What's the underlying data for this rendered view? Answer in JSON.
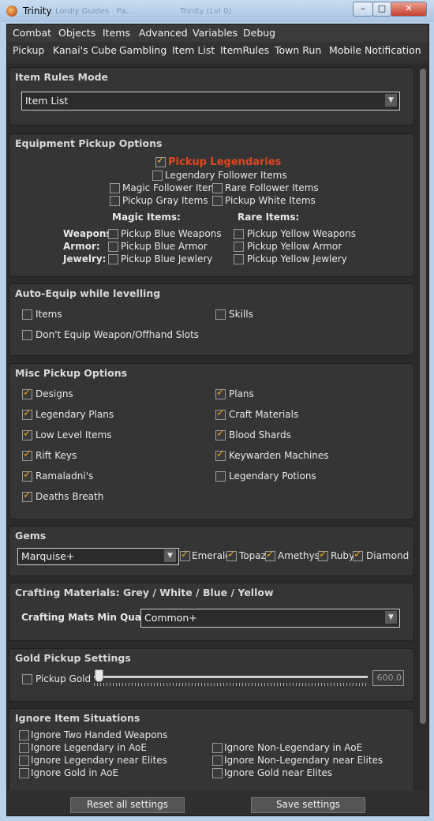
{
  "window": {
    "title": "Trinity",
    "ghost_title_1": "Lordly Guides · Pa...",
    "ghost_title_2": "Trinity (Lvl 0)",
    "btn_min": "–",
    "btn_max": "□",
    "btn_close": "✕"
  },
  "menu1": [
    "Combat",
    "Objects",
    "Items",
    "Advanced",
    "Variables",
    "Debug"
  ],
  "menu2": [
    "Pickup",
    "Kanai's Cube",
    "Gambling",
    "Item List",
    "ItemRules",
    "Town Run",
    "Mobile Notification"
  ],
  "item_rules_mode": {
    "title": "Item Rules Mode",
    "selected": "Item List"
  },
  "equipment": {
    "title": "Equipment Pickup Options",
    "pickup_legendaries": {
      "label": "Pickup Legendaries",
      "checked": true
    },
    "legendary_follower": {
      "label": "Legendary Follower Items",
      "checked": false
    },
    "magic_follower": {
      "label": "Magic Follower Items",
      "checked": false
    },
    "rare_follower": {
      "label": "Rare Follower Items",
      "checked": false
    },
    "gray_items": {
      "label": "Pickup Gray Items",
      "checked": false
    },
    "white_items": {
      "label": "Pickup White Items",
      "checked": false
    },
    "magic_header": "Magic Items:",
    "rare_header": "Rare Items:",
    "row_weapons": "Weapons:",
    "row_armor": "Armor:",
    "row_jewelry": "Jewelry:",
    "blue_weapons": {
      "label": "Pickup Blue Weapons",
      "checked": false
    },
    "blue_armor": {
      "label": "Pickup Blue Armor",
      "checked": false
    },
    "blue_jewlery": {
      "label": "Pickup Blue Jewlery",
      "checked": false
    },
    "yellow_weapons": {
      "label": "Pickup Yellow Weapons",
      "checked": false
    },
    "yellow_armor": {
      "label": "Pickup Yellow Armor",
      "checked": false
    },
    "yellow_jewlery": {
      "label": "Pickup Yellow Jewlery",
      "checked": false
    }
  },
  "auto_equip": {
    "title": "Auto-Equip while levelling",
    "items": {
      "label": "Items",
      "checked": false
    },
    "skills": {
      "label": "Skills",
      "checked": false
    },
    "dont_equip": {
      "label": "Don't Equip Weapon/Offhand Slots",
      "checked": false
    }
  },
  "misc": {
    "title": "Misc Pickup Options",
    "designs": {
      "label": "Designs",
      "checked": true
    },
    "plans": {
      "label": "Plans",
      "checked": true
    },
    "legendary_plans": {
      "label": "Legendary Plans",
      "checked": true
    },
    "craft_materials": {
      "label": "Craft Materials",
      "checked": true
    },
    "low_level": {
      "label": "Low Level Items",
      "checked": true
    },
    "blood_shards": {
      "label": "Blood Shards",
      "checked": true
    },
    "rift_keys": {
      "label": "Rift Keys",
      "checked": true
    },
    "keywarden": {
      "label": "Keywarden Machines",
      "checked": true
    },
    "ramaladni": {
      "label": "Ramaladni's",
      "checked": true
    },
    "legendary_potions": {
      "label": "Legendary Potions",
      "checked": false
    },
    "deaths_breath": {
      "label": "Deaths Breath",
      "checked": true
    }
  },
  "gems": {
    "title": "Gems",
    "selected": "Marquise+",
    "emerald": {
      "label": "Emerald",
      "checked": true
    },
    "topaz": {
      "label": "Topaz",
      "checked": true
    },
    "amethyst": {
      "label": "Amethyst",
      "checked": true
    },
    "ruby": {
      "label": "Ruby",
      "checked": true
    },
    "diamond": {
      "label": "Diamond",
      "checked": true
    }
  },
  "crafting": {
    "title": "Crafting Materials: Grey / White / Blue / Yellow",
    "min_quality_label": "Crafting Mats Min Quality:",
    "selected": "Common+"
  },
  "gold": {
    "title": "Gold Pickup Settings",
    "pickup_gold": {
      "label": "Pickup Gold",
      "checked": false
    },
    "value": "600.0",
    "slider_fraction": 0.0
  },
  "ignore": {
    "title": "Ignore Item Situations",
    "two_handed": {
      "label": "Ignore Two Handed Weapons",
      "checked": false
    },
    "legendary_aoe": {
      "label": "Ignore Legendary in AoE",
      "checked": false
    },
    "nonlegendary_aoe": {
      "label": "Ignore Non-Legendary in AoE",
      "checked": false
    },
    "legendary_elites": {
      "label": "Ignore Legendary near Elites",
      "checked": false
    },
    "nonlegendary_elites": {
      "label": "Ignore Non-Legendary near Elites",
      "checked": false
    },
    "gold_aoe": {
      "label": "Ignore Gold in AoE",
      "checked": false
    },
    "gold_elites": {
      "label": "Ignore Gold near Elites",
      "checked": false
    }
  },
  "buttons": {
    "reset": "Reset all settings",
    "save": "Save settings"
  }
}
